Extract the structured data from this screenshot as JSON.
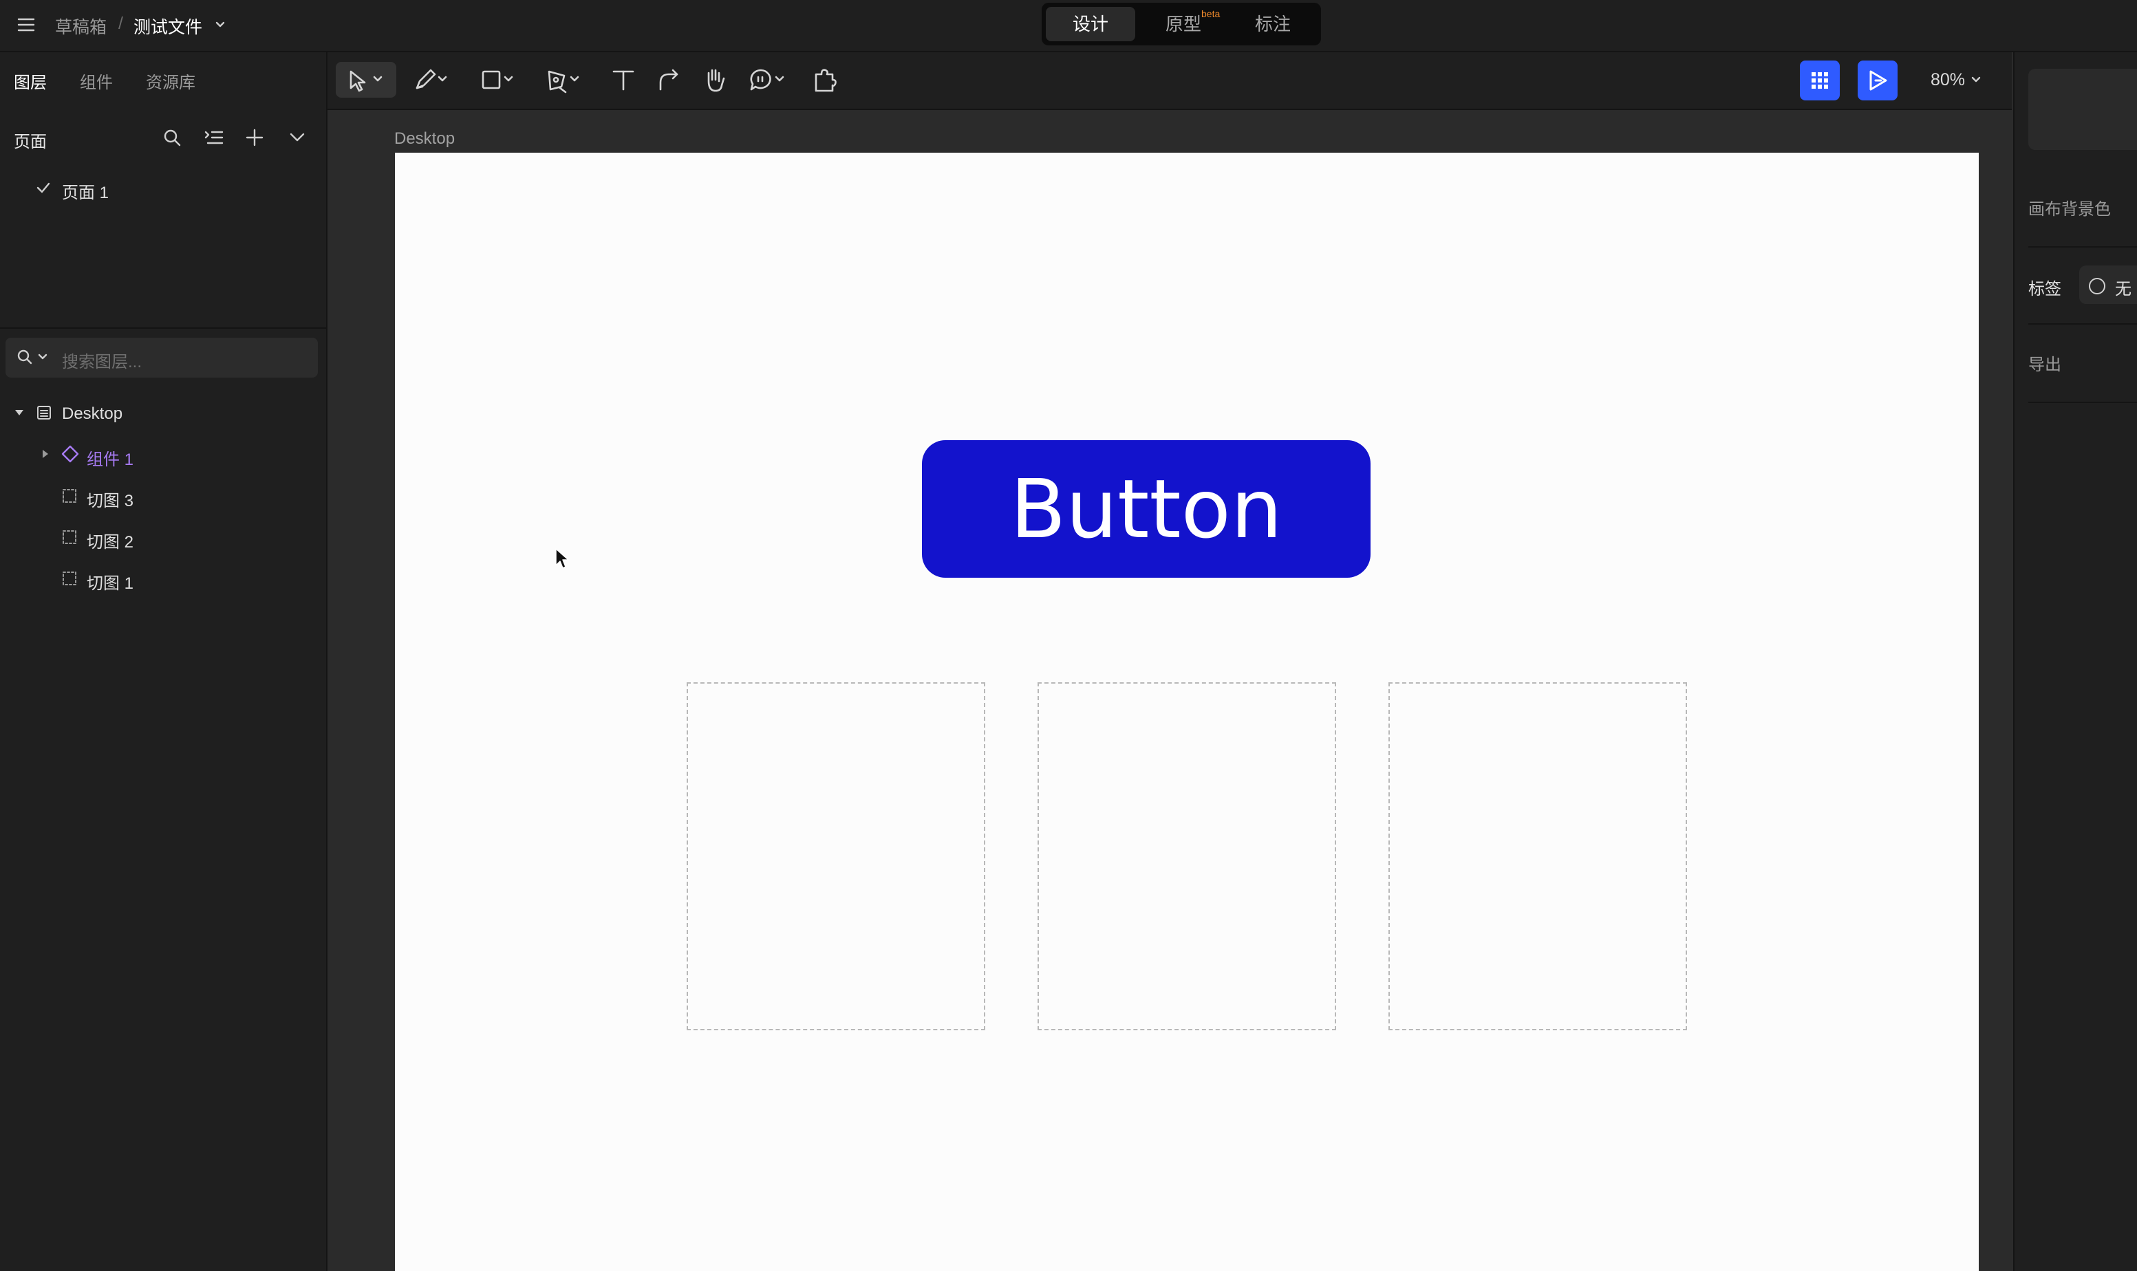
{
  "header": {
    "breadcrumb_folder": "草稿箱",
    "breadcrumb_sep": "/",
    "file_name": "测试文件",
    "modes": [
      {
        "label": "设计",
        "active": true
      },
      {
        "label": "原型",
        "badge": "beta",
        "active": false
      },
      {
        "label": "标注",
        "active": false
      }
    ]
  },
  "left_panel": {
    "tabs": [
      {
        "label": "图层",
        "active": true
      },
      {
        "label": "组件",
        "active": false
      },
      {
        "label": "资源库",
        "active": false
      }
    ],
    "pages_title": "页面",
    "pages": [
      {
        "label": "页面 1",
        "selected": true
      }
    ],
    "search_placeholder": "搜索图层...",
    "layers": [
      {
        "label": "Desktop",
        "type": "frame",
        "expanded": true
      },
      {
        "label": "组件 1",
        "type": "component",
        "expanded": false
      },
      {
        "label": "切图 3",
        "type": "slice"
      },
      {
        "label": "切图 2",
        "type": "slice"
      },
      {
        "label": "切图 1",
        "type": "slice"
      }
    ]
  },
  "toolbar": {
    "tools": [
      "move-tool",
      "pencil-tool",
      "rectangle-tool",
      "pen-tool",
      "text-tool",
      "connector-tool",
      "hand-tool",
      "comment-tool",
      "plugin-tool"
    ],
    "zoom": "80%"
  },
  "canvas": {
    "frame_label": "Desktop",
    "button_text": "Button",
    "colors": {
      "button_bg": "#1313cc",
      "canvas_bg": "#2b2b2b",
      "frame_bg": "#fcfcfc",
      "accent": "#2f5bff",
      "component": "#a77bf3"
    }
  },
  "right_panel": {
    "canvas_bg_label": "画布背景色",
    "tag_label": "标签",
    "tag_value": "无",
    "export_label": "导出"
  }
}
